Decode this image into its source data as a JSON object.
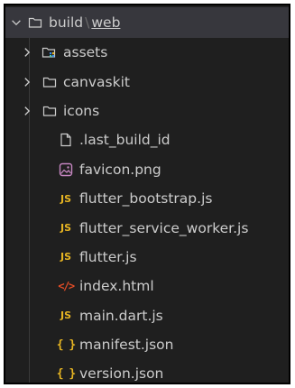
{
  "explorer": {
    "root": {
      "name": "build",
      "separator": "\\",
      "compressed_child": "web",
      "expanded": true
    },
    "items": [
      {
        "label": "assets",
        "kind": "folder",
        "icon": "assets-folder-icon"
      },
      {
        "label": "canvaskit",
        "kind": "folder",
        "icon": "folder-icon"
      },
      {
        "label": "icons",
        "kind": "folder",
        "icon": "folder-icon"
      },
      {
        "label": ".last_build_id",
        "kind": "file",
        "icon": "file-icon"
      },
      {
        "label": "favicon.png",
        "kind": "file",
        "icon": "image-icon"
      },
      {
        "label": "flutter_bootstrap.js",
        "kind": "file",
        "icon": "js-icon",
        "icon_text": "JS"
      },
      {
        "label": "flutter_service_worker.js",
        "kind": "file",
        "icon": "js-icon",
        "icon_text": "JS"
      },
      {
        "label": "flutter.js",
        "kind": "file",
        "icon": "js-icon",
        "icon_text": "JS"
      },
      {
        "label": "index.html",
        "kind": "file",
        "icon": "html-icon",
        "icon_text": "</>"
      },
      {
        "label": "main.dart.js",
        "kind": "file",
        "icon": "js-icon",
        "icon_text": "JS"
      },
      {
        "label": "manifest.json",
        "kind": "file",
        "icon": "json-icon",
        "icon_text": "{ }"
      },
      {
        "label": "version.json",
        "kind": "file",
        "icon": "json-icon",
        "icon_text": "{ }"
      }
    ]
  },
  "colors": {
    "background": "#1f1f1f",
    "selected_row": "#37373d",
    "text": "#cccccc",
    "js_icon": "#e6b422",
    "json_icon": "#e6b422",
    "html_icon": "#e44d26",
    "image_icon": "#c586c0",
    "assets_icon_accent": "#3b8eea"
  }
}
